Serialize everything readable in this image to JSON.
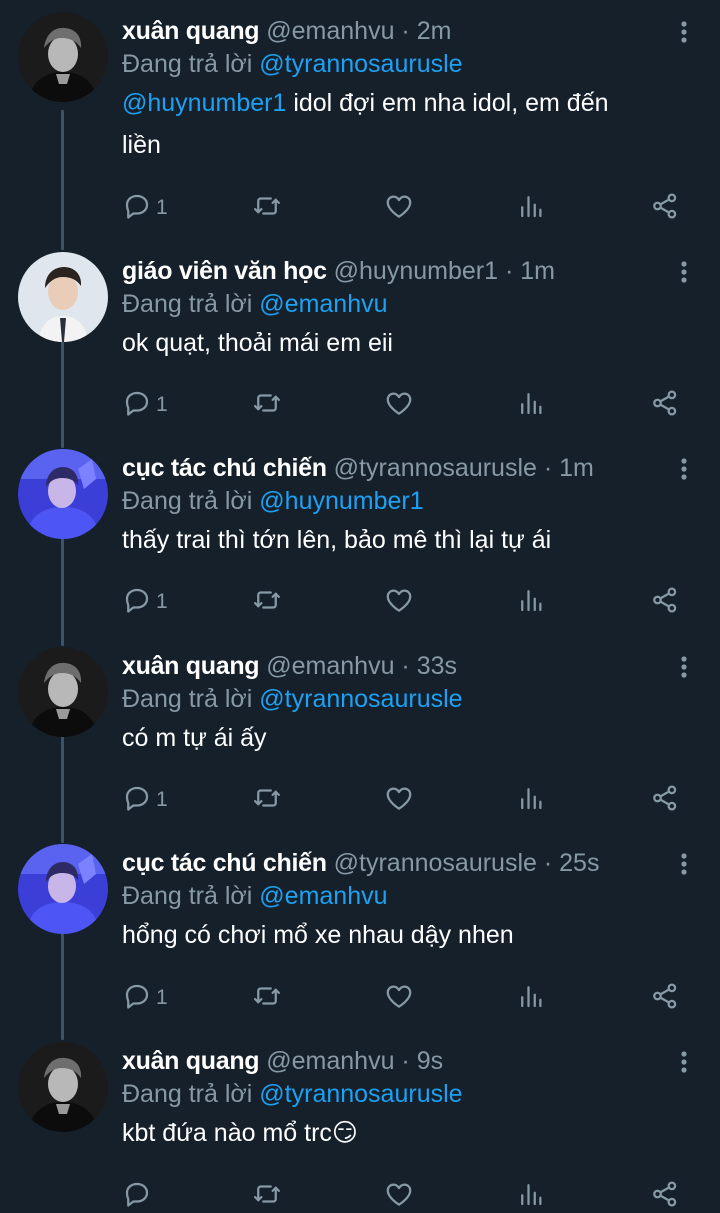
{
  "labels": {
    "replying_to": "Đang trả lời"
  },
  "tweets": [
    {
      "name": "xuân quang",
      "handle": "@emanhvu",
      "time": "2m",
      "reply_to": "@tyrannosaurusle",
      "mention": "@huynumber1",
      "text": "idol đợi em nha idol, em đến",
      "text2": "liền",
      "reply_count": "1",
      "avatar": "gray"
    },
    {
      "name": "giáo viên văn học",
      "handle": "@huynumber1",
      "time": "1m",
      "reply_to": "@emanhvu",
      "mention": "",
      "text": "ok quạt, thoải mái em eii",
      "text2": "",
      "reply_count": "1",
      "avatar": "light"
    },
    {
      "name": "cục tác chú chiến",
      "handle": "@tyrannosaurusle",
      "time": "1m",
      "reply_to": "@huynumber1",
      "mention": "",
      "text": "thấy trai thì tớn lên, bảo mê thì lại tự ái",
      "text2": "",
      "reply_count": "1",
      "avatar": "blue"
    },
    {
      "name": "xuân quang",
      "handle": "@emanhvu",
      "time": "33s",
      "reply_to": "@tyrannosaurusle",
      "mention": "",
      "text": "có m tự ái ấy",
      "text2": "",
      "reply_count": "1",
      "avatar": "gray"
    },
    {
      "name": "cục tác chú chiến",
      "handle": "@tyrannosaurusle",
      "time": "25s",
      "reply_to": "@emanhvu",
      "mention": "",
      "text": "hổng có chơi mổ xe nhau dậy nhen",
      "text2": "",
      "reply_count": "1",
      "avatar": "blue"
    },
    {
      "name": "xuân quang",
      "handle": "@emanhvu",
      "time": "9s",
      "reply_to": "@tyrannosaurusle",
      "mention": "",
      "text": "kbt đứa nào mổ trc😏",
      "text2": "",
      "reply_count": "",
      "avatar": "gray"
    }
  ],
  "icons": {
    "reply": "reply-icon",
    "retweet": "retweet-icon",
    "like": "heart-icon",
    "analytics": "analytics-icon",
    "share": "share-icon",
    "more": "more-vertical-icon"
  },
  "colors": {
    "background": "#15202b",
    "accent": "#1da1f2",
    "muted": "#8899a6",
    "thread_line": "#3d5466"
  }
}
